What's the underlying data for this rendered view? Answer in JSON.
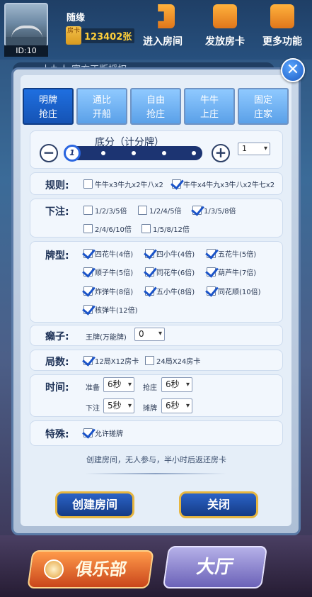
{
  "profile": {
    "username": "随缘",
    "id_label": "ID:10",
    "card_icon_label": "房卡",
    "card_count": "123402张"
  },
  "top_buttons": {
    "enter_room": "进入房间",
    "issue_card": "发放房卡",
    "more": "更多功能"
  },
  "marquee": "十九人  官方正版授权",
  "dialog": {
    "close": "✕",
    "tabs": [
      {
        "line1": "明牌",
        "line2": "抢庄"
      },
      {
        "line1": "通比",
        "line2": "开船"
      },
      {
        "line1": "自由",
        "line2": "抢庄"
      },
      {
        "line1": "牛牛",
        "line2": "上庄"
      },
      {
        "line1": "固定",
        "line2": "庄家"
      }
    ],
    "base_score": {
      "title": "底分（计分牌）",
      "minus": "−",
      "plus": "+",
      "knob_value": "1",
      "select_value": "1"
    },
    "rules": {
      "label": "规则:",
      "options": [
        {
          "text": "牛牛x3牛九x2牛八x2",
          "checked": false
        },
        {
          "text": "牛牛x4牛九x3牛八x2牛七x2",
          "checked": true
        }
      ]
    },
    "bet": {
      "label": "下注:",
      "options": [
        {
          "text": "1/2/3/5倍",
          "checked": false
        },
        {
          "text": "1/2/4/5倍",
          "checked": false
        },
        {
          "text": "1/3/5/8倍",
          "checked": true
        },
        {
          "text": "2/4/6/10倍",
          "checked": false
        },
        {
          "text": "1/5/8/12倍",
          "checked": false
        }
      ]
    },
    "hands": {
      "label": "牌型:",
      "options": [
        {
          "text": "四花牛(4倍)",
          "checked": true
        },
        {
          "text": "四小牛(4倍)",
          "checked": true
        },
        {
          "text": "五花牛(5倍)",
          "checked": true
        },
        {
          "text": "顺子牛(5倍)",
          "checked": true
        },
        {
          "text": "同花牛(6倍)",
          "checked": true
        },
        {
          "text": "葫芦牛(7倍)",
          "checked": true
        },
        {
          "text": "炸弹牛(8倍)",
          "checked": true
        },
        {
          "text": "五小牛(8倍)",
          "checked": true
        },
        {
          "text": "同花顺(10倍)",
          "checked": true
        },
        {
          "text": "核弹牛(12倍)",
          "checked": true
        }
      ]
    },
    "joker": {
      "label": "癞子:",
      "text": "王牌(万能牌)",
      "value": "0"
    },
    "rounds": {
      "label": "局数:",
      "options": [
        {
          "text": "12局X12房卡",
          "checked": true
        },
        {
          "text": "24局X24房卡",
          "checked": false
        }
      ]
    },
    "time": {
      "label": "时间:",
      "prepare_label": "准备",
      "prepare_value": "6秒",
      "grab_label": "抢庄",
      "grab_value": "6秒",
      "bet_label": "下注",
      "bet_value": "5秒",
      "show_label": "摊牌",
      "show_value": "6秒"
    },
    "special": {
      "label": "特殊:",
      "option": {
        "text": "允许搓牌",
        "checked": true
      }
    },
    "footnote": "创建房间，无人参与，半小时后返还房卡",
    "create_button": "创建房间",
    "close_button": "关闭"
  },
  "bottom_nav": {
    "club": "俱乐部",
    "hall": "大厅"
  }
}
